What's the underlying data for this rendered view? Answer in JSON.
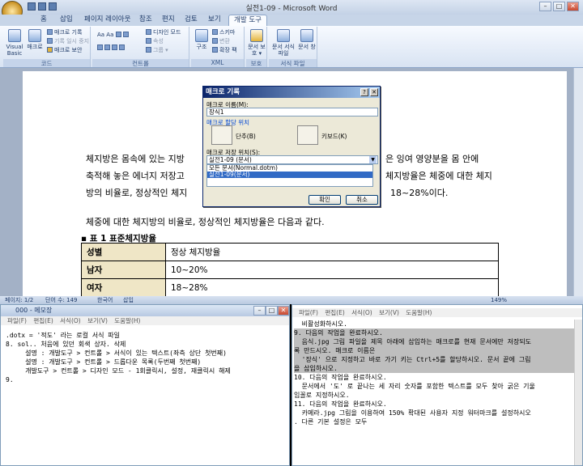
{
  "word": {
    "title": "실전1-09 - Microsoft Word",
    "tabs": [
      "홈",
      "삽입",
      "페이지 레이아웃",
      "참조",
      "편지",
      "검토",
      "보기",
      "개발 도구"
    ],
    "active_tab_index": 7,
    "ribbon": {
      "code": {
        "label": "코드",
        "visual_basic": "Visual Basic",
        "macro": "매크로",
        "record": "매크로 기록",
        "pause": "기록 일시 중지",
        "security": "매크로 보안"
      },
      "controls": {
        "label": "컨트롤",
        "design_mode": "디자인 모드",
        "properties": "속성",
        "group": "그룹 ▾"
      },
      "xml": {
        "label": "XML",
        "structure": "구조",
        "schema": "스키마",
        "transform": "변환",
        "expansion": "확장 팩"
      },
      "protect": {
        "label": "보호",
        "protect_doc": "문서 보호 ▾"
      },
      "templates": {
        "label": "서식 파일",
        "doc_template": "문서 서식 파일",
        "doc_panel": "문서 창"
      }
    },
    "document": {
      "para1_line1": "체지방은 몸속에 있는 지방",
      "para1_line1_right": "은 잉여 영양분을 몸 안에",
      "para1_line2": "축적해 놓은 에너지 저장고",
      "para1_line2_right": "체지방율은 체중에 대한 체지",
      "para1_line3": "방의 비율로, 정상적인 체지",
      "para1_line3_right": "18~28%이다.",
      "para2": "체중에 대한 체지방의 비율로, 정상적인 체지방율은 다음과 같다.",
      "table_caption": "표 1 표준체지방율",
      "table_rows": [
        {
          "header": "성별",
          "value": "정상 체지방율"
        },
        {
          "header": "남자",
          "value": "10~20%"
        },
        {
          "header": "여자",
          "value": "18~28%"
        }
      ]
    },
    "status": {
      "page": "페이지: 1/2",
      "words": "단어 수: 149",
      "language": "한국어",
      "mode": "삽입",
      "zoom": "149%"
    }
  },
  "dialog": {
    "title": "매크로 기록",
    "name_label": "매크로 이름(M):",
    "name_value": "장식1",
    "assign_label": "매크로 할당 위치",
    "button_label": "단추(B)",
    "keyboard_label": "키보드(K)",
    "store_label": "매크로 저장 위치(S):",
    "store_value": "실전1-09 (문서)",
    "list_items": [
      "모든 문서(Normal.dotm)",
      "실전1-09(문서)"
    ],
    "selected_index": 1,
    "ok": "확인",
    "cancel": "취소"
  },
  "notepad": {
    "title": "000 - 메모장",
    "menu": [
      "파일(F)",
      "편집(E)",
      "서식(O)",
      "보기(V)",
      "도움말(H)"
    ],
    "lines": [
      ".dotx = '적도' 라는 로컬 서식 파일",
      "",
      "8. sol.. 처음에 있던 회색 상자. 삭제",
      "     설명 : 개발도구 > 컨트롤 > 서식이 있는 텍스트(좌측 상단 첫번째)",
      "     설명 : 개발도구 > 컨트롤 > 드롭다운 목록(두번째 첫번째)",
      "     개발도구 > 컨트롤 > 디자인 모드 - 1회클릭시, 설정, 재클릭시 해제",
      "",
      "",
      "9."
    ]
  },
  "right_pane": {
    "menu": [
      "파일(F)",
      "편집(E)",
      "서식(O)",
      "보기(V)",
      "도움말(H)"
    ],
    "lines": [
      {
        "text": "  비활성화하시오.",
        "hl": false
      },
      {
        "text": "",
        "hl": false
      },
      {
        "text": "9. 다음의 작업을 완료하시오.",
        "hl": true
      },
      {
        "text": "  음식.jpg 그림 파일을 제목 아래에 삽입하는 매크로를 현재 문서에만 저장되도",
        "hl": true
      },
      {
        "text": "록 만드시오. 매크로 이름은",
        "hl": true
      },
      {
        "text": "  '장식' 으로 지정하고 바로 가기 키는 Ctrl+5를 할당하시오. 문서 끝에 그림",
        "hl": true
      },
      {
        "text": "을 삽입하시오.",
        "hl": true
      },
      {
        "text": "",
        "hl": false
      },
      {
        "text": "10. 다음의 작업을 완료하시오.",
        "hl": false
      },
      {
        "text": "  문서에서 '도' 로 끝나는 세 자리 숫자를 포함한 텍스트를 모두 찾아 굵은 기울",
        "hl": false
      },
      {
        "text": "임꼴로 지정하시오.",
        "hl": false
      },
      {
        "text": "",
        "hl": false
      },
      {
        "text": "",
        "hl": false
      },
      {
        "text": "11. 다음의 작업을 완료하시오.",
        "hl": false
      },
      {
        "text": "  카메라.jpg 그림을 이용하여 150% 확대된 사용자 지정 워터마크를 설정하시오",
        "hl": false
      },
      {
        "text": ". 다른 기본 설정은 모두",
        "hl": false
      }
    ]
  }
}
